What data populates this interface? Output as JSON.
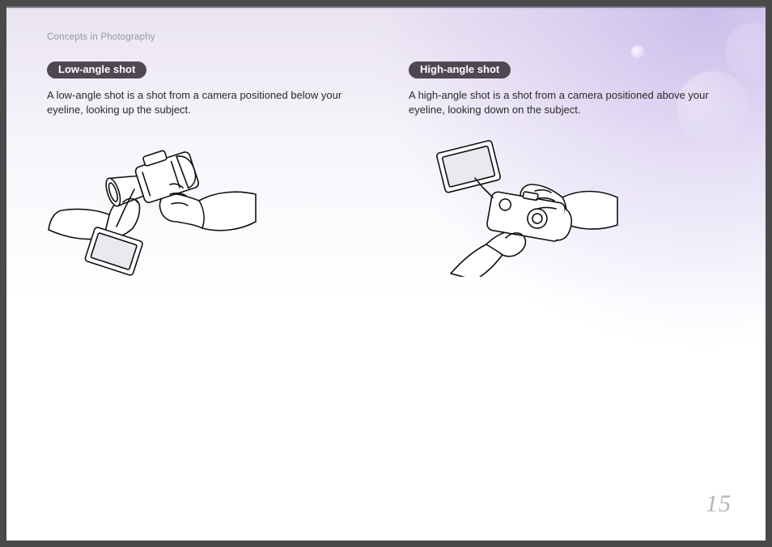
{
  "section_label": "Concepts in Photography",
  "columns": {
    "left": {
      "heading": "Low-angle shot",
      "body": "A low-angle shot is a shot from a camera positioned below your eyeline, looking up the subject."
    },
    "right": {
      "heading": "High-angle shot",
      "body": "A high-angle shot is a shot from a camera positioned above your eyeline, looking down on the subject."
    }
  },
  "page_number": "15",
  "colors": {
    "accent": "#d01050",
    "pill_bg": "#4f4853"
  }
}
